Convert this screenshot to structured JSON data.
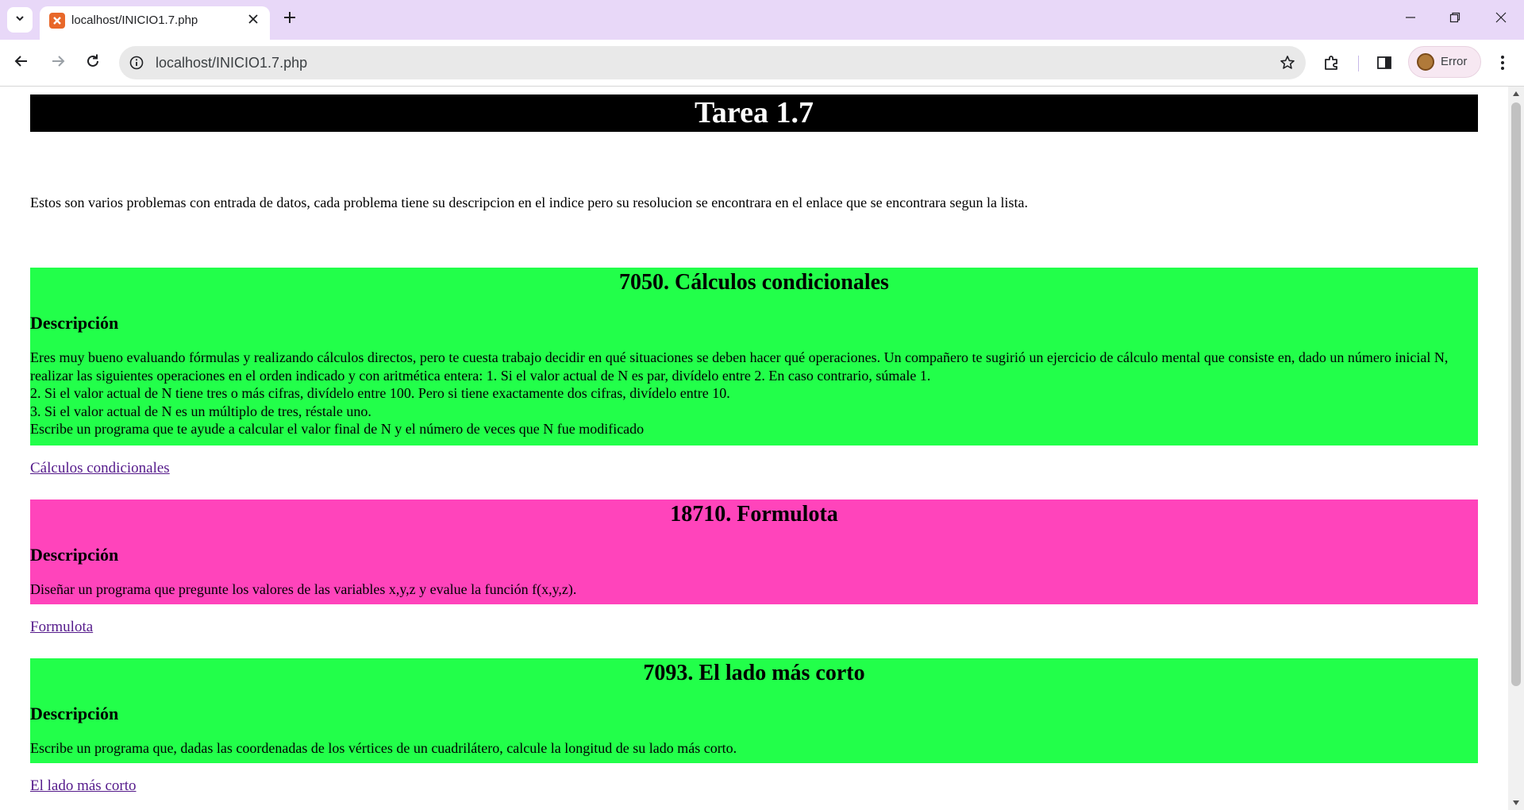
{
  "browser": {
    "tab_title": "localhost/INICIO1.7.php",
    "url": "localhost/INICIO1.7.php",
    "profile_label": "Error",
    "icons": {
      "tab_search": "chevron-down-icon",
      "favicon": "xampp-icon",
      "tab_close": "close-icon",
      "new_tab": "plus-icon",
      "minimize": "minimize-icon",
      "restore": "restore-icon",
      "close": "close-icon",
      "back": "arrow-left-icon",
      "forward": "arrow-right-icon",
      "reload": "reload-icon",
      "site_info": "info-icon",
      "bookmark": "star-icon",
      "extensions": "puzzle-icon",
      "side_panel": "side-panel-icon",
      "menu": "kebab-menu-icon"
    }
  },
  "page": {
    "title": "Tarea 1.7",
    "intro": "Estos son varios problemas con entrada de datos, cada problema tiene su descripcion en el indice pero su resolucion se encontrara en el enlace que se encontrara segun la lista.",
    "sections": [
      {
        "title": "7050. Cálculos condicionales",
        "subtitle": "Descripción",
        "body": "Eres muy bueno evaluando fórmulas y realizando cálculos directos, pero te cuesta trabajo decidir en qué situaciones se deben hacer qué operaciones. Un compañero te sugirió un ejercicio de cálculo mental que consiste en, dado un número inicial N, realizar las siguientes operaciones en el orden indicado y con aritmética entera: 1. Si el valor actual de N es par, divídelo entre 2. En caso contrario, súmale 1.\n2. Si el valor actual de N tiene tres o más cifras, divídelo entre 100. Pero si tiene exactamente dos cifras, divídelo entre 10.\n3. Si el valor actual de N es un múltiplo de tres, réstale uno.\nEscribe un programa que te ayude a calcular el valor final de N y el número de veces que N fue modificado",
        "link": "Cálculos condicionales",
        "color": "#22ff4a"
      },
      {
        "title": "18710. Formulota",
        "subtitle": "Descripción",
        "body": "Diseñar un programa que pregunte los valores de las variables x,y,z y evalue la función f(x,y,z).",
        "link": "Formulota",
        "color": "#ff44bb"
      },
      {
        "title": "7093. El lado más corto",
        "subtitle": "Descripción",
        "body": "Escribe un programa que, dadas las coordenadas de los vértices de un cuadrilátero, calcule la longitud de su lado más corto.",
        "link": "El lado más corto",
        "color": "#22ff4a"
      }
    ]
  }
}
